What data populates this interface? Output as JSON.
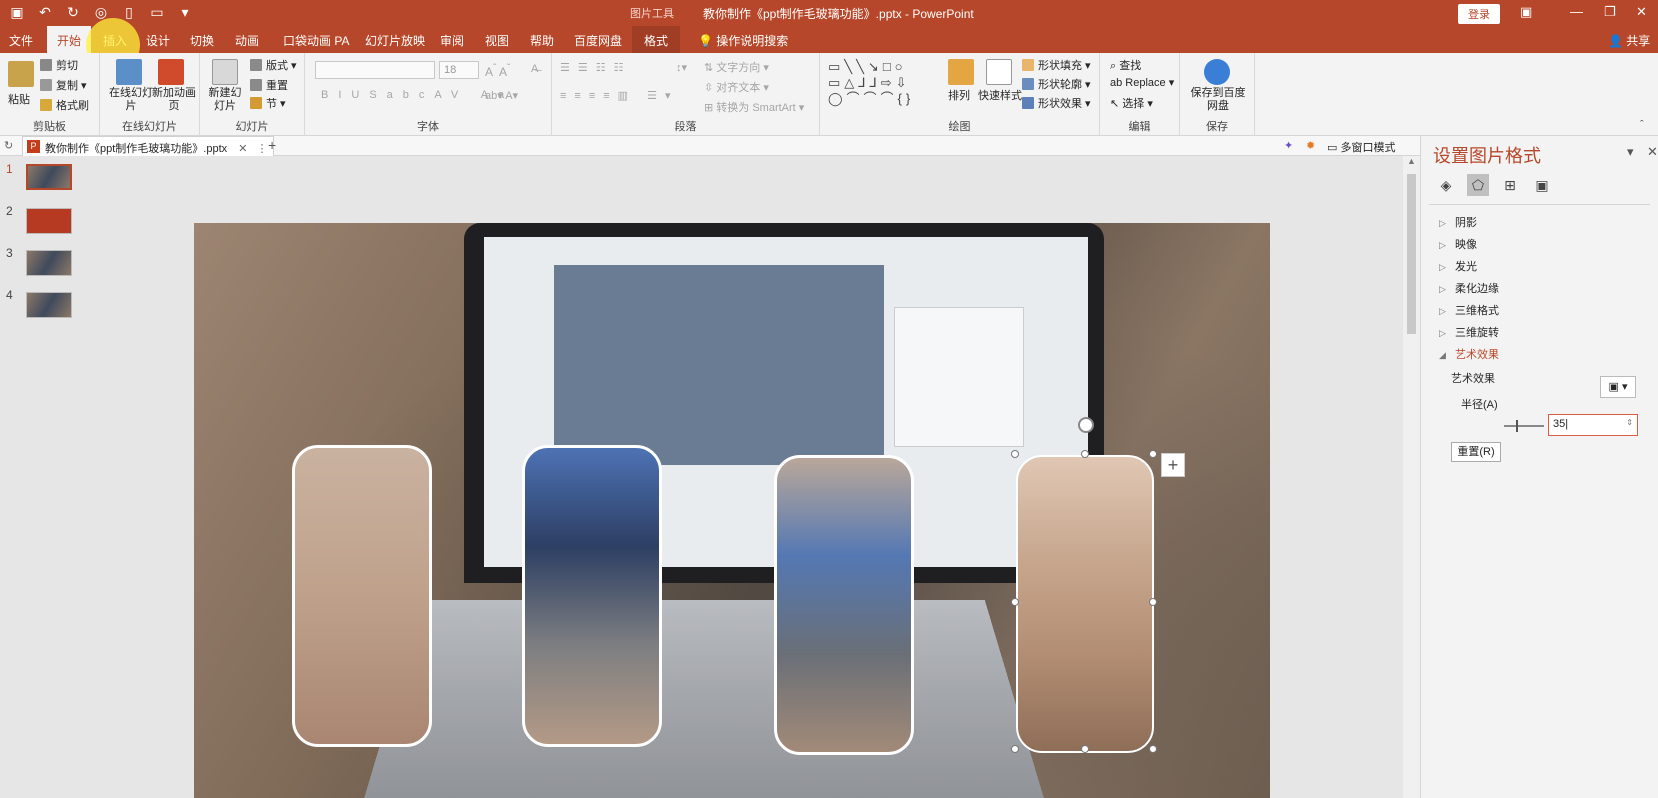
{
  "titlebar": {
    "context_tool": "图片工具",
    "document_title": "教你制作《ppt制作毛玻璃功能》.pptx - PowerPoint",
    "login": "登录"
  },
  "tabs": {
    "items": [
      "文件",
      "开始",
      "插入",
      "设计",
      "切换",
      "动画",
      "口袋动画 PA",
      "幻灯片放映",
      "审阅",
      "视图",
      "帮助",
      "百度网盘",
      "格式"
    ],
    "active": "开始",
    "tell_me": "操作说明搜索",
    "share": "共享"
  },
  "ribbon": {
    "clipboard": {
      "paste": "粘贴",
      "cut": "剪切",
      "copy": "复制",
      "format_painter": "格式刷",
      "label": "剪贴板"
    },
    "online_slides": {
      "online": "在线幻灯片",
      "new_anim": "新加动画页",
      "label": "在线幻灯片"
    },
    "slides": {
      "new_slide": "新建幻灯片",
      "layout": "版式",
      "reset": "重置",
      "section": "节",
      "label": "幻灯片"
    },
    "font": {
      "size": "18",
      "label": "字体"
    },
    "paragraph": {
      "text_direction": "文字方向",
      "align_text": "对齐文本",
      "smartart": "转换为 SmartArt",
      "label": "段落"
    },
    "drawing": {
      "arrange": "排列",
      "quick_styles": "快速样式",
      "fill": "形状填充",
      "outline": "形状轮廓",
      "effects": "形状效果",
      "label": "绘图"
    },
    "editing": {
      "find": "查找",
      "replace": "Replace",
      "select": "选择",
      "label": "编辑"
    },
    "save": {
      "save_baidu": "保存到百度网盘",
      "label": "保存"
    }
  },
  "docbar": {
    "tab": "教你制作《ppt制作毛玻璃功能》.pptx",
    "multi_window": "多窗口模式"
  },
  "thumbnails": [
    "1",
    "2",
    "3",
    "4"
  ],
  "pane": {
    "title": "设置图片格式",
    "sections": [
      "阴影",
      "映像",
      "发光",
      "柔化边缘",
      "三维格式",
      "三维旋转",
      "艺术效果"
    ],
    "artistic_label": "艺术效果",
    "radius_label": "半径(A)",
    "radius_value": "35",
    "reset": "重置(R)"
  }
}
